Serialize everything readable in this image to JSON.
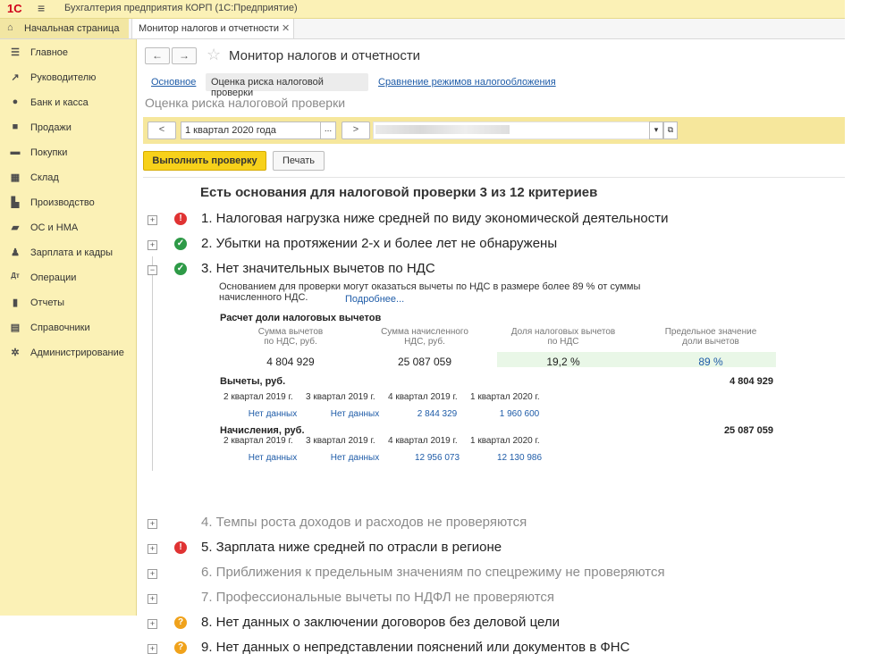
{
  "window": {
    "app_title": "Бухгалтерия предприятия КОРП  (1С:Предприятие)",
    "logo": "1С"
  },
  "tabs": {
    "home": "Начальная страница",
    "active": "Монитор налогов и отчетности"
  },
  "sidebar": {
    "items": [
      {
        "label": "Главное",
        "icon": "menu-lines-icon"
      },
      {
        "label": "Руководителю",
        "icon": "trend-icon"
      },
      {
        "label": "Банк и касса",
        "icon": "coin-icon"
      },
      {
        "label": "Продажи",
        "icon": "bag-icon"
      },
      {
        "label": "Покупки",
        "icon": "cart-icon"
      },
      {
        "label": "Склад",
        "icon": "warehouse-icon"
      },
      {
        "label": "Производство",
        "icon": "factory-icon"
      },
      {
        "label": "ОС и НМА",
        "icon": "truck-icon"
      },
      {
        "label": "Зарплата и кадры",
        "icon": "person-icon"
      },
      {
        "label": "Операции",
        "icon": "operations-icon"
      },
      {
        "label": "Отчеты",
        "icon": "bar-chart-icon"
      },
      {
        "label": "Справочники",
        "icon": "book-icon"
      },
      {
        "label": "Администрирование",
        "icon": "gear-icon"
      }
    ]
  },
  "page": {
    "title": "Монитор налогов и отчетности",
    "subtabs": {
      "main": "Основное",
      "risk": "Оценка риска налоговой проверки",
      "compare": "Сравнение режимов налогообложения"
    },
    "section_title": "Оценка риска налоговой проверки",
    "period": "1 квартал 2020 года",
    "buttons": {
      "prev": "<",
      "next": ">",
      "dots": "...",
      "run": "Выполнить проверку",
      "print": "Печать"
    }
  },
  "report": {
    "header": "Есть основания для налоговой проверки 3 из 12 критериев",
    "criteria": [
      {
        "text": "1.  Налоговая нагрузка ниже средней по виду экономической деятельности",
        "status": "red",
        "toggle": "+"
      },
      {
        "text": "2.  Убытки на протяжении 2-х и более лет не обнаружены",
        "status": "green",
        "toggle": "+"
      },
      {
        "text": "3.  Нет значительных вычетов по НДС",
        "status": "green",
        "toggle": "−"
      },
      {
        "text": "4.  Темпы роста доходов и расходов не проверяются",
        "status": "none",
        "toggle": "+"
      },
      {
        "text": "5.  Зарплата ниже средней по отрасли в регионе",
        "status": "red",
        "toggle": "+"
      },
      {
        "text": "6.  Приближения к предельным значениям по спецрежиму не проверяются",
        "status": "none",
        "toggle": "+"
      },
      {
        "text": "7.  Профессиональные вычеты по НДФЛ не проверяются",
        "status": "none",
        "toggle": "+"
      },
      {
        "text": "8.  Нет данных о заключении договоров без деловой цели",
        "status": "orange",
        "toggle": "+"
      },
      {
        "text": "9.  Нет данных о непредставлении пояснений или документов в ФНС",
        "status": "orange",
        "toggle": "+"
      }
    ],
    "detail": {
      "basis": "Основанием для проверки могут оказаться вычеты по НДС в размере более 89 % от суммы начисленного НДС.",
      "more": "Подробнее...",
      "calc_title": "Расчет доли налоговых вычетов",
      "headers": [
        "Сумма вычетов\nпо НДС, руб.",
        "Сумма начисленного\nНДС, руб.",
        "Доля налоговых вычетов\nпо НДС",
        "Предельное значение\nдоли вычетов"
      ],
      "values": [
        "4 804 929",
        "25 087 059",
        "19,2 %",
        "89 %"
      ],
      "deductions_label": "Вычеты, руб.",
      "deductions_total": "4 804 929",
      "accruals_label": "Начисления, руб.",
      "accruals_total": "25 087 059",
      "quarters": [
        "2 квартал 2019 г.",
        "3 квартал 2019 г.",
        "4 квартал 2019 г.",
        "1 квартал 2020 г."
      ],
      "deductions": [
        "Нет данных",
        "Нет данных",
        "2 844 329",
        "1 960 600"
      ],
      "accruals": [
        "Нет данных",
        "Нет данных",
        "12 956 073",
        "12 130 986"
      ]
    }
  },
  "colors": {
    "panel": "#fbf1b6",
    "accent_button": "#f7d11a",
    "link": "#1f5ca8",
    "red": "#e03333",
    "green": "#2e9a47",
    "orange": "#f0a21b"
  }
}
